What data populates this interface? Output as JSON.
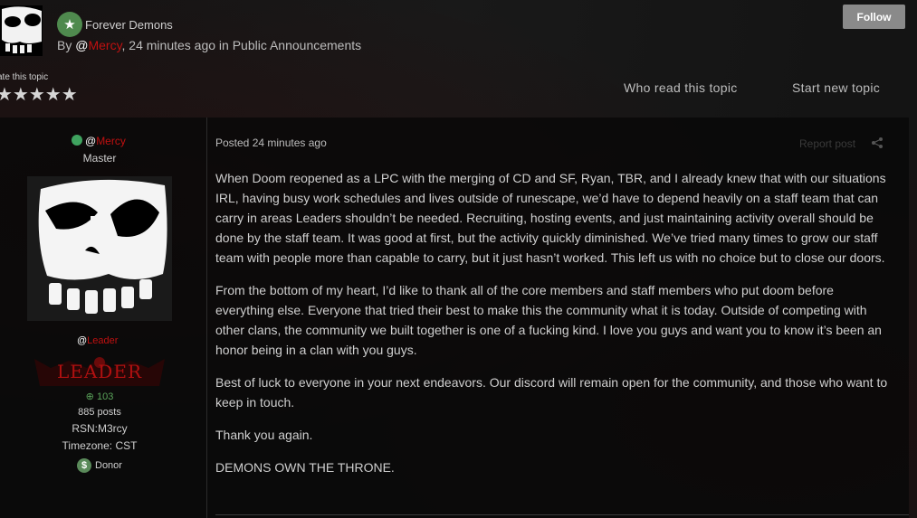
{
  "header": {
    "forum_name": "Forever Demons",
    "by_prefix": "By ",
    "author_at": "@",
    "author": "Mercy",
    "byline_rest": ", 24 minutes ago in Public Announcements",
    "follow_label": "Follow",
    "rate_label": "ate this topic",
    "rating_stars": "★★★★★",
    "who_read_label": "Who read this topic",
    "start_topic_label": "Start new topic"
  },
  "author_panel": {
    "name_at": "@",
    "name": "Mercy",
    "title": "Master",
    "group_at": "@",
    "group": "Leader",
    "banner_text": "LEADER",
    "reputation": "103",
    "post_count": "885 posts",
    "rsn": "RSN:M3rcy",
    "timezone": "Timezone: CST",
    "donor_label": "Donor",
    "donor_icon_glyph": "$"
  },
  "post": {
    "posted": "Posted 24 minutes ago",
    "report_label": "Report post",
    "paragraphs": [
      "When Doom reopened as a LPC with the merging of CD and SF, Ryan, TBR, and I already knew that with our situations IRL, having busy work schedules and lives outside of runescape, we’d have to depend heavily on a staff team that can carry in areas Leaders shouldn’t be needed. Recruiting, hosting events, and just maintaining activity overall should be done by the staff team. It was good at first, but the activity quickly diminished. We’ve tried many times to grow our staff team with people more than capable to carry, but it just hasn’t worked. This left us with no choice but to close our doors.",
      "From the bottom of my heart, I’d like to thank all of the core members and staff members who put doom before everything else. Everyone that tried their best to make this the community what it is today. Outside of competing with other clans, the community we built together is one of a fucking kind. I love you guys and want you to know it’s been an honor being in a clan with you guys.",
      "Best of luck to everyone in your next endeavors. Our discord will remain open for the community, and those who want to keep in touch.",
      "Thank you again.",
      "DEMONS OWN THE THRONE."
    ]
  },
  "colors": {
    "accent_red": "#c01010",
    "online_green": "#3fa35f",
    "button_gray": "#8a8a8a"
  },
  "icons": [
    "skull-avatar-icon",
    "star-icon",
    "share-icon",
    "rep-plus-icon",
    "donor-dollar-icon"
  ]
}
